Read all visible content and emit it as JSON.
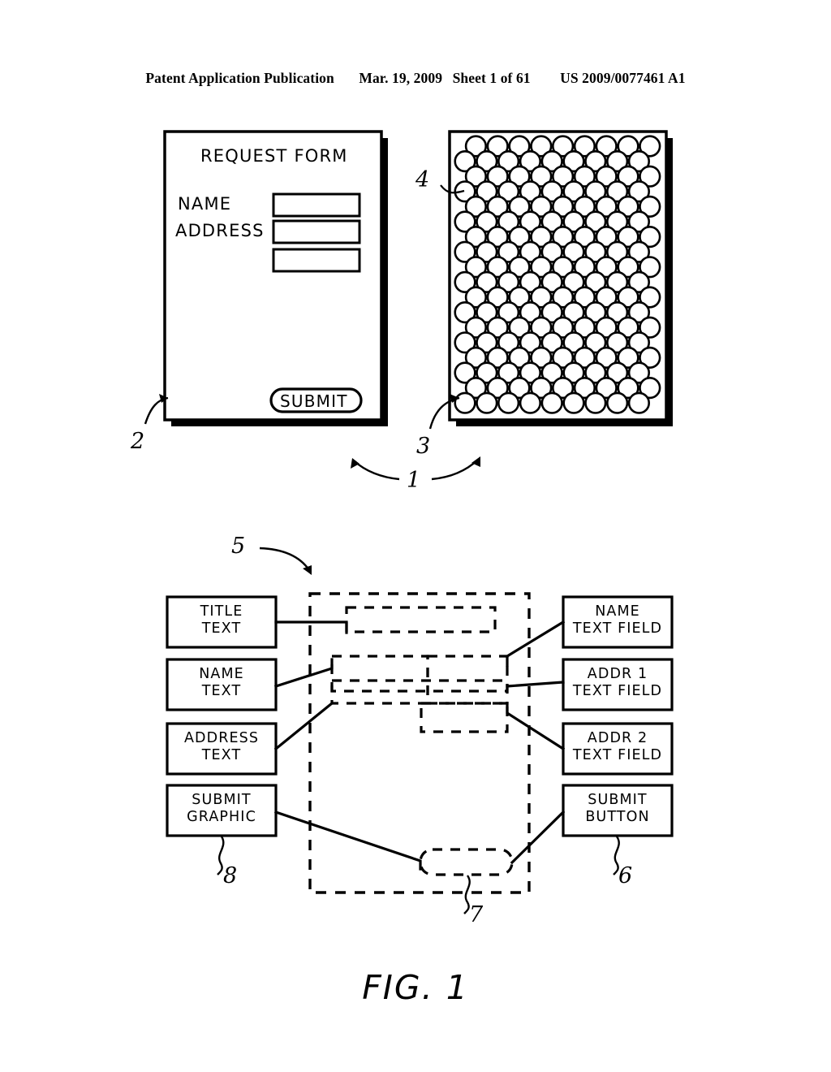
{
  "header": {
    "publication": "Patent Application Publication",
    "date": "Mar. 19, 2009",
    "sheet": "Sheet 1 of 61",
    "patent_number": "US 2009/0077461 A1"
  },
  "figure": {
    "caption": "FIG. 1"
  },
  "request_form": {
    "title": "REQUEST FORM",
    "name_label": "NAME",
    "address_label": "ADDRESS",
    "submit_label": "SUBMIT",
    "fields": [
      {
        "value": "",
        "placeholder": ""
      },
      {
        "value": "",
        "placeholder": ""
      },
      {
        "value": "",
        "placeholder": ""
      }
    ]
  },
  "dot_pattern": {
    "columns": 10,
    "rows": 18,
    "description": "surface coding dot pattern"
  },
  "left_boxes": [
    {
      "line1": "TITLE",
      "line2": "TEXT"
    },
    {
      "line1": "NAME",
      "line2": "TEXT"
    },
    {
      "line1": "ADDRESS",
      "line2": "TEXT"
    },
    {
      "line1": "SUBMIT",
      "line2": "GRAPHIC"
    }
  ],
  "right_boxes": [
    {
      "line1": "NAME",
      "line2": "TEXT FIELD"
    },
    {
      "line1": "ADDR 1",
      "line2": "TEXT FIELD"
    },
    {
      "line1": "ADDR 2",
      "line2": "TEXT FIELD"
    },
    {
      "line1": "SUBMIT",
      "line2": "BUTTON"
    }
  ],
  "reference_numerals": {
    "n1": "1",
    "n2": "2",
    "n3": "3",
    "n4": "4",
    "n5": "5",
    "n6": "6",
    "n7": "7",
    "n8": "8"
  },
  "colors": {
    "ink": "#000000",
    "paper": "#ffffff",
    "shadow": "#000000"
  }
}
